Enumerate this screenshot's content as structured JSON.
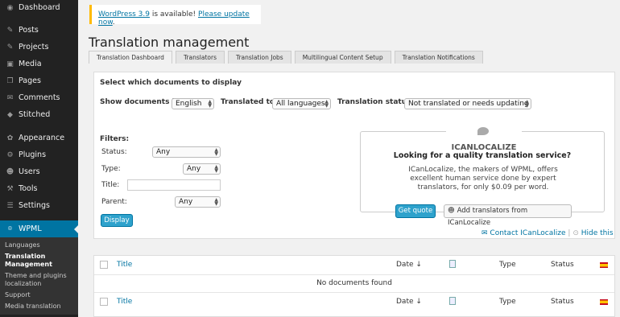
{
  "sidebar": {
    "items": [
      {
        "label": "Dashboard",
        "icon": "dashboard-icon",
        "glyph": "◉"
      },
      {
        "label": "Posts",
        "icon": "pin-icon",
        "glyph": "✎"
      },
      {
        "label": "Projects",
        "icon": "pin-icon",
        "glyph": "✎"
      },
      {
        "label": "Media",
        "icon": "media-icon",
        "glyph": "▣"
      },
      {
        "label": "Pages",
        "icon": "pages-icon",
        "glyph": "❐"
      },
      {
        "label": "Comments",
        "icon": "comment-icon",
        "glyph": "✉"
      },
      {
        "label": "Stitched",
        "icon": "stitched-icon",
        "glyph": "◆"
      },
      {
        "label": "Appearance",
        "icon": "brush-icon",
        "glyph": "✿"
      },
      {
        "label": "Plugins",
        "icon": "plug-icon",
        "glyph": "⚙"
      },
      {
        "label": "Users",
        "icon": "user-icon",
        "glyph": "☻"
      },
      {
        "label": "Tools",
        "icon": "wrench-icon",
        "glyph": "⚒"
      },
      {
        "label": "Settings",
        "icon": "settings-icon",
        "glyph": "☰"
      },
      {
        "label": "WPML",
        "icon": "wpml-icon",
        "glyph": "⌾"
      }
    ],
    "submenu": [
      "Languages",
      "Translation Management",
      "Theme and plugins localization",
      "Support",
      "Media translation"
    ]
  },
  "notice": {
    "link_version": "WordPress 3.9",
    "text": " is available! ",
    "link_update": "Please update now",
    "end": "."
  },
  "page_title": "Translation management",
  "tabs": [
    "Translation Dashboard",
    "Translators",
    "Translation Jobs",
    "Multilingual Content Setup",
    "Translation Notifications"
  ],
  "filter": {
    "section_title": "Select which documents to display",
    "show_in_label": "Show documents in:",
    "show_in_value": "English",
    "translated_to_label": "Translated to:",
    "translated_to_value": "All languages",
    "status_label": "Translation status:",
    "status_value": "Not translated or needs updating",
    "filters_label": "Filters:",
    "status_filter_label": "Status:",
    "status_filter_value": "Any",
    "type_label": "Type:",
    "type_value": "Any",
    "title_label": "Title:",
    "parent_label": "Parent:",
    "parent_value": "Any",
    "display_button": "Display"
  },
  "promo": {
    "logo_text": "ICANLOCALIZE",
    "heading": "Looking for a quality translation service?",
    "body": "ICanLocalize, the makers of WPML, offers excellent human service done by expert translators, for only $0.09 per word.",
    "get_quote": "Get quote",
    "add_translators": "Add translators from ICanLocalize",
    "contact_link": "Contact ICanLocalize",
    "hide_link": "Hide this"
  },
  "table": {
    "columns": {
      "title": "Title",
      "date": "Date",
      "type": "Type",
      "status": "Status"
    },
    "empty_text": "No documents found",
    "flag_language": "Spanish"
  },
  "colors": {
    "accent": "#0074a2",
    "button": "#2ea2cc",
    "sidebar": "#222222"
  }
}
